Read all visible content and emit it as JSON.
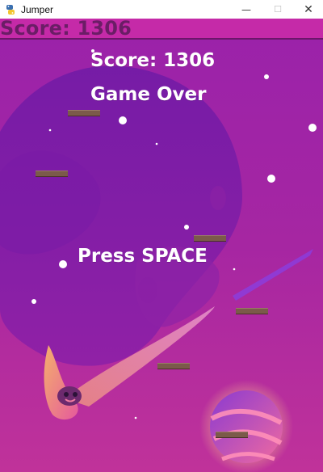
{
  "window": {
    "title": "Jumper",
    "app_icon": "python-icon",
    "controls": [
      "minimize-icon",
      "maximize-icon",
      "close-icon"
    ]
  },
  "hud": {
    "score_label": "Score: 1306"
  },
  "overlay": {
    "score_text": "Score: 1306",
    "game_over_text": "Game Over",
    "prompt_text": "Press SPACE"
  },
  "colors": {
    "hud_bar": "#c52aa8",
    "hud_text": "#6b1d66",
    "overlay_text": "#ffffff",
    "platform": "#7b5a4a",
    "sky_top": "#8a1fa8",
    "sky_bottom": "#c12d97"
  },
  "platforms_count": 6
}
